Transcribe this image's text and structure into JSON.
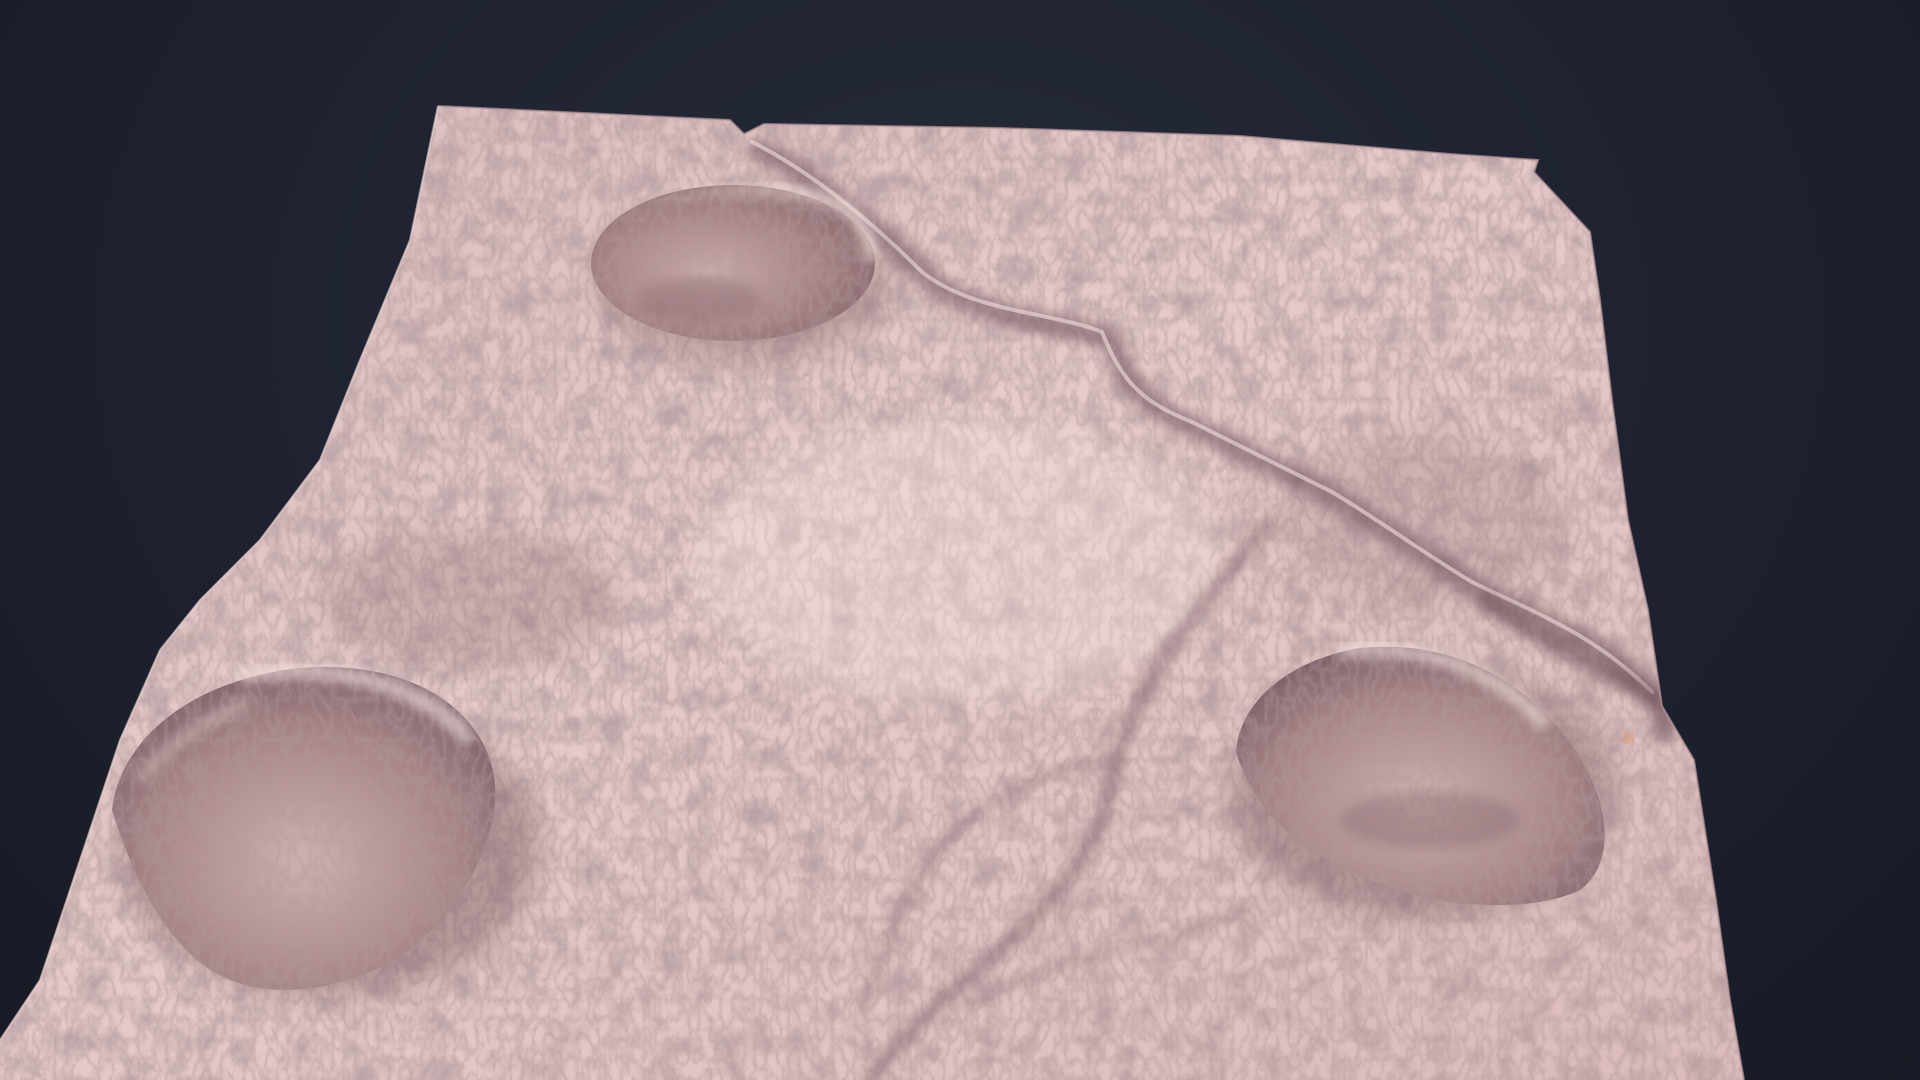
{
  "scene": {
    "subject": "terrain-heightmap-render",
    "colors": {
      "background": "#1e2230",
      "terrain_base": "#e2c6c6",
      "terrain_highlight": "#f6e4e2",
      "terrain_shadow": "#8e6e72",
      "crater_shadow": "#9c7c80",
      "canyon": "#6e5058",
      "accent_glow": "#ff8a3a"
    },
    "features": {
      "craters": 3,
      "canyons": 2
    }
  }
}
